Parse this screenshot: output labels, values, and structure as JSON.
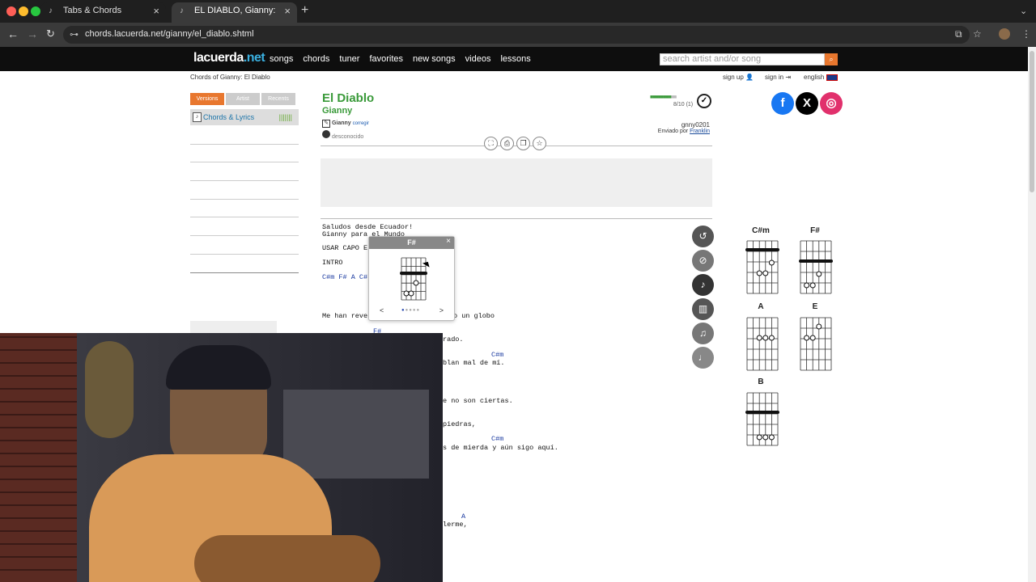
{
  "browser": {
    "tabs": [
      {
        "label": "Tabs & Chords"
      },
      {
        "label": "EL DIABLO, Gianny: Chords"
      }
    ],
    "url": "chords.lacuerda.net/gianny/el_diablo.shtml"
  },
  "site": {
    "logo": {
      "part1": "lacuerda",
      "part2": ".net"
    },
    "nav": [
      "songs",
      "chords",
      "tuner",
      "favorites",
      "new songs",
      "videos",
      "lessons"
    ],
    "search_placeholder": "search artist and/or song",
    "breadcrumb": "Chords of Gianny: El Diablo",
    "sign_up": "sign up",
    "sign_in": "sign in",
    "language": "english"
  },
  "sidebar": {
    "tabs": [
      "Versions",
      "Artist",
      "Recents"
    ],
    "item": "Chords & Lyrics",
    "item_bars": "|||||||"
  },
  "song": {
    "title": "El Diablo",
    "artist": "Gianny",
    "meta_artist": "Gianny",
    "meta_edit": "corregir",
    "meta_unknown": "desconocido",
    "rating_value": 8,
    "rating_text": "8/10 (1)",
    "poster": "gnny0201",
    "sent_by_label": "Enviado por",
    "sent_by": "Franklin"
  },
  "lyrics": {
    "l1": "Saludos desde Ecuador!",
    "l2": "Gianny para el Mundo",
    "l3": "USAR CAPO E",
    "l4": "INTRO",
    "c1": "C#m F# A C#",
    "l5a": "Me han reve",
    "l5b": "o un globo",
    "c2": "F#",
    "l6": "rado.",
    "c3": "C#m",
    "l7": "blan mal de mí.",
    "l8": "e no son ciertas.",
    "l9": "piedras,",
    "c4": "C#m",
    "l10": "s de mierda y aún sigo aquí.",
    "c5": "A",
    "l11": "lerme,"
  },
  "popup": {
    "chord": "F#",
    "close": "×",
    "prev": "<",
    "next": ">"
  },
  "chord_diagrams": [
    "C#m",
    "F#",
    "A",
    "E",
    "B"
  ],
  "colors": {
    "green": "#3a9a3a",
    "orange": "#e8772e",
    "chord_blue": "#1a3aa0"
  }
}
